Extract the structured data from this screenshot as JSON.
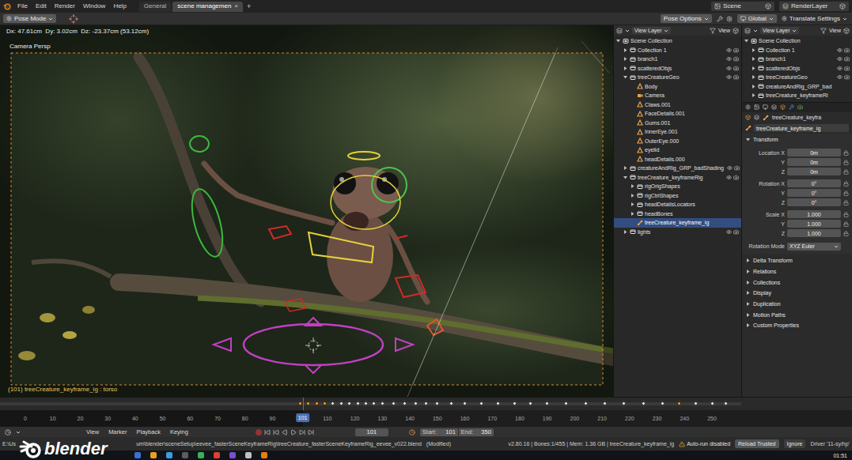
{
  "top_bar": {
    "menus": [
      "File",
      "Edit",
      "Render",
      "Window",
      "Help"
    ],
    "workspaces": [
      {
        "label": "General",
        "selected": false
      },
      {
        "label": "scene managemen",
        "selected": true
      }
    ],
    "close": "×",
    "add": "+",
    "scene": "Scene",
    "view_layer": "RenderLayer"
  },
  "tool_header": {
    "mode": "Pose Mode",
    "pose_options": "Pose Options",
    "orientation": "Global",
    "settings": "Translate Settings"
  },
  "viewport": {
    "header_text": "Dx: 47.61cm  Dy: 3.02cm  Dz: -23.37cm (53.12cm)",
    "view_name": "Camera Persp",
    "object_info": "(101) treeCreature_keyframe_ig : torso"
  },
  "outliner": {
    "display_mode": "View Layer",
    "view_menu": "View",
    "rows": [
      {
        "label": "Scene Collection",
        "kind": "scene",
        "expanded": true,
        "selected": false,
        "children": [
          {
            "label": "Collection 1",
            "kind": "collection",
            "expanded": false,
            "selected": false,
            "visible": true
          },
          {
            "label": "branch1",
            "kind": "collection",
            "expanded": false,
            "selected": false,
            "visible": true
          },
          {
            "label": "scatteredObjs",
            "kind": "collection",
            "expanded": false,
            "selected": false,
            "visible": true
          },
          {
            "label": "treeCreatureGeo",
            "kind": "collection",
            "expanded": true,
            "selected": false,
            "visible": true,
            "children": [
              {
                "label": "Body",
                "kind": "mesh",
                "selected": false
              },
              {
                "label": "Camera",
                "kind": "camera",
                "selected": false
              },
              {
                "label": "Claws.001",
                "kind": "mesh",
                "selected": false
              },
              {
                "label": "FaceDetails.001",
                "kind": "mesh",
                "selected": false
              },
              {
                "label": "Gums.001",
                "kind": "mesh",
                "selected": false
              },
              {
                "label": "InnerEye.001",
                "kind": "mesh",
                "selected": false
              },
              {
                "label": "OuterEye.000",
                "kind": "mesh",
                "selected": false
              },
              {
                "label": "eyelid",
                "kind": "mesh",
                "selected": false
              },
              {
                "label": "headDetails.000",
                "kind": "mesh",
                "selected": false
              }
            ]
          },
          {
            "label": "creatureAndRig_GRP_badShading",
            "kind": "collection",
            "expanded": false,
            "selected": false,
            "visible": true
          },
          {
            "label": "treeCreature_keyframeRig",
            "kind": "collection",
            "expanded": true,
            "selected": false,
            "visible": true,
            "children": [
              {
                "label": "rigOrigShapes",
                "kind": "collection",
                "expanded": false,
                "selected": false
              },
              {
                "label": "rigCtrlShapes",
                "kind": "collection",
                "expanded": false,
                "selected": false
              },
              {
                "label": "headDetailsLocators",
                "kind": "collection",
                "expanded": false,
                "selected": false
              },
              {
                "label": "headBones",
                "kind": "collection",
                "expanded": false,
                "selected": false
              },
              {
                "label": "treeCreature_keyframe_ig",
                "kind": "armature",
                "selected": true
              }
            ]
          },
          {
            "label": "lights",
            "kind": "collection",
            "expanded": false,
            "selected": false,
            "visible": true
          }
        ]
      }
    ]
  },
  "mini_outliner": {
    "display_mode": "View Layer",
    "view_menu": "View",
    "rows": [
      {
        "label": "Scene Collection",
        "kind": "scene",
        "expanded": true,
        "selected": false,
        "children": [
          {
            "label": "Collection 1",
            "kind": "collection",
            "expanded": false,
            "selected": false,
            "visible": true
          },
          {
            "label": "branch1",
            "kind": "collection",
            "expanded": false,
            "selected": false,
            "visible": true
          },
          {
            "label": "scatteredObjs",
            "kind": "collection",
            "expanded": false,
            "selected": false,
            "visible": true
          },
          {
            "label": "treeCreatureGeo",
            "kind": "collection",
            "expanded": false,
            "selected": false,
            "visible": true
          },
          {
            "label": "creatureAndRig_GRP_bad",
            "kind": "collection",
            "expanded": false,
            "selected": false
          },
          {
            "label": "treeCreature_keyframeRi",
            "kind": "collection",
            "expanded": false,
            "selected": false
          }
        ]
      }
    ]
  },
  "properties": {
    "breadcrumb": "treeCreature_keyfra",
    "name": "treeCreature_keyframe_ig",
    "transform": {
      "title": "Transform",
      "expanded": true,
      "groups": [
        [
          {
            "label": "Location X",
            "value": "0m"
          },
          {
            "label": "Y",
            "value": "0m"
          },
          {
            "label": "Z",
            "value": "0m"
          }
        ],
        [
          {
            "label": "Rotation X",
            "value": "0°"
          },
          {
            "label": "Y",
            "value": "0°"
          },
          {
            "label": "Z",
            "value": "0°"
          }
        ],
        [
          {
            "label": "Scale X",
            "value": "1.000"
          },
          {
            "label": "Y",
            "value": "1.000"
          },
          {
            "label": "Z",
            "value": "1.000"
          }
        ]
      ],
      "rotation_mode": {
        "label": "Rotation Mode",
        "value": "XYZ Euler"
      }
    },
    "sections": [
      {
        "title": "Delta Transform",
        "expanded": false
      },
      {
        "title": "Relations",
        "expanded": false
      },
      {
        "title": "Collections",
        "expanded": false
      },
      {
        "title": "Display",
        "expanded": false
      },
      {
        "title": "Duplication",
        "expanded": false
      },
      {
        "title": "Motion Paths",
        "expanded": false
      },
      {
        "title": "Custom Properties",
        "expanded": false
      }
    ]
  },
  "timeline": {
    "ticks": [
      "0",
      "10",
      "20",
      "30",
      "40",
      "50",
      "60",
      "70",
      "80",
      "90",
      "110",
      "120",
      "130",
      "140",
      "150",
      "160",
      "170",
      "180",
      "190",
      "200",
      "210",
      "220",
      "230",
      "240",
      "250"
    ],
    "current_frame": "101",
    "keyframes": [
      {
        "frame": 100,
        "selected": true
      },
      {
        "frame": 103,
        "selected": true
      },
      {
        "frame": 106,
        "selected": true
      },
      {
        "frame": 109,
        "selected": true
      },
      {
        "frame": 112,
        "selected": false
      },
      {
        "frame": 115,
        "selected": false
      },
      {
        "frame": 118,
        "selected": false
      },
      {
        "frame": 121,
        "selected": false
      },
      {
        "frame": 124,
        "selected": false
      },
      {
        "frame": 127,
        "selected": false
      },
      {
        "frame": 130,
        "selected": false
      },
      {
        "frame": 134,
        "selected": false
      },
      {
        "frame": 138,
        "selected": false
      },
      {
        "frame": 142,
        "selected": false
      },
      {
        "frame": 146,
        "selected": false
      },
      {
        "frame": 150,
        "selected": false
      },
      {
        "frame": 155,
        "selected": false
      },
      {
        "frame": 160,
        "selected": false
      },
      {
        "frame": 166,
        "selected": false
      },
      {
        "frame": 172,
        "selected": false
      },
      {
        "frame": 178,
        "selected": false
      },
      {
        "frame": 184,
        "selected": false
      },
      {
        "frame": 190,
        "selected": false
      },
      {
        "frame": 197,
        "selected": false
      },
      {
        "frame": 204,
        "selected": false
      },
      {
        "frame": 211,
        "selected": false
      },
      {
        "frame": 218,
        "selected": false
      },
      {
        "frame": 225,
        "selected": false
      },
      {
        "frame": 232,
        "selected": false
      },
      {
        "frame": 238,
        "selected": true
      },
      {
        "frame": 244,
        "selected": false
      },
      {
        "frame": 250,
        "selected": false
      },
      {
        "frame": 255,
        "selected": false
      }
    ]
  },
  "timeline_header": {
    "menus": [
      "View",
      "Marker",
      "Playback",
      "Keying"
    ],
    "frame": "101",
    "start_label": "Start:",
    "start": "101",
    "end_label": "End:",
    "end": "350"
  },
  "status_bar": {
    "path_start": "E:\\Us",
    "path_rest": "um\\blender\\sceneSetup\\eevee_fasterSceneKeyframeRig\\treeCreature_fasterSceneKeyframeRig_eevee_v022.blend",
    "modified": "(Modified)",
    "stats": "v2.80.16 | Bones:1/455 | Mem: 1.36 GB | treeCreature_keyframe_ig",
    "warning": "Auto-run disabled",
    "buttons": [
      "Reload Trusted",
      "Ignore"
    ],
    "driver": "Driver '11-sy/hp'"
  },
  "watermark": "blender",
  "taskbar": {
    "clock": "01:51"
  }
}
